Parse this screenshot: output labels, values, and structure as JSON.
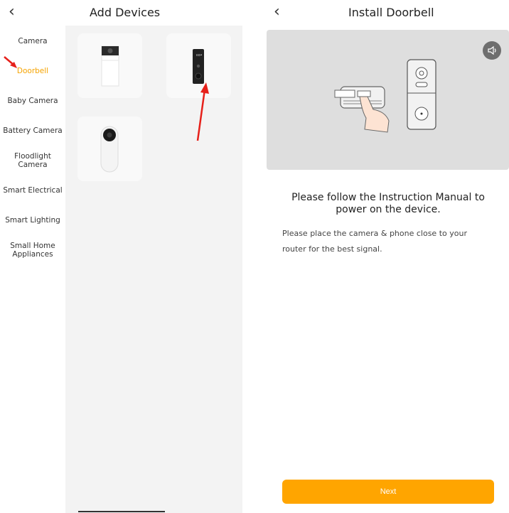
{
  "left": {
    "title": "Add Devices",
    "back_glyph": "‹",
    "categories": [
      {
        "label": "Camera"
      },
      {
        "label": "Doorbell"
      },
      {
        "label": "Baby Camera"
      },
      {
        "label": "Battery Camera"
      },
      {
        "label": "Floodlight Camera"
      },
      {
        "label": "Smart Electrical"
      },
      {
        "label": "Smart Lighting"
      },
      {
        "label": "Small Home Appliances"
      }
    ],
    "active_category": "Doorbell",
    "devices": [
      {
        "icon": "white-doorbell-icon"
      },
      {
        "icon": "black-doorbell-icon"
      },
      {
        "icon": "round-doorbell-icon"
      }
    ]
  },
  "right": {
    "title": "Install Doorbell",
    "back_glyph": "‹",
    "heading": "Please follow the Instruction Manual to power on the device.",
    "description": "Please place the camera & phone close to your router for the best signal.",
    "next_label": "Next"
  },
  "colors": {
    "accent": "#ffa500",
    "active_text": "#f5a300",
    "annotation_arrow": "#e6201a"
  }
}
